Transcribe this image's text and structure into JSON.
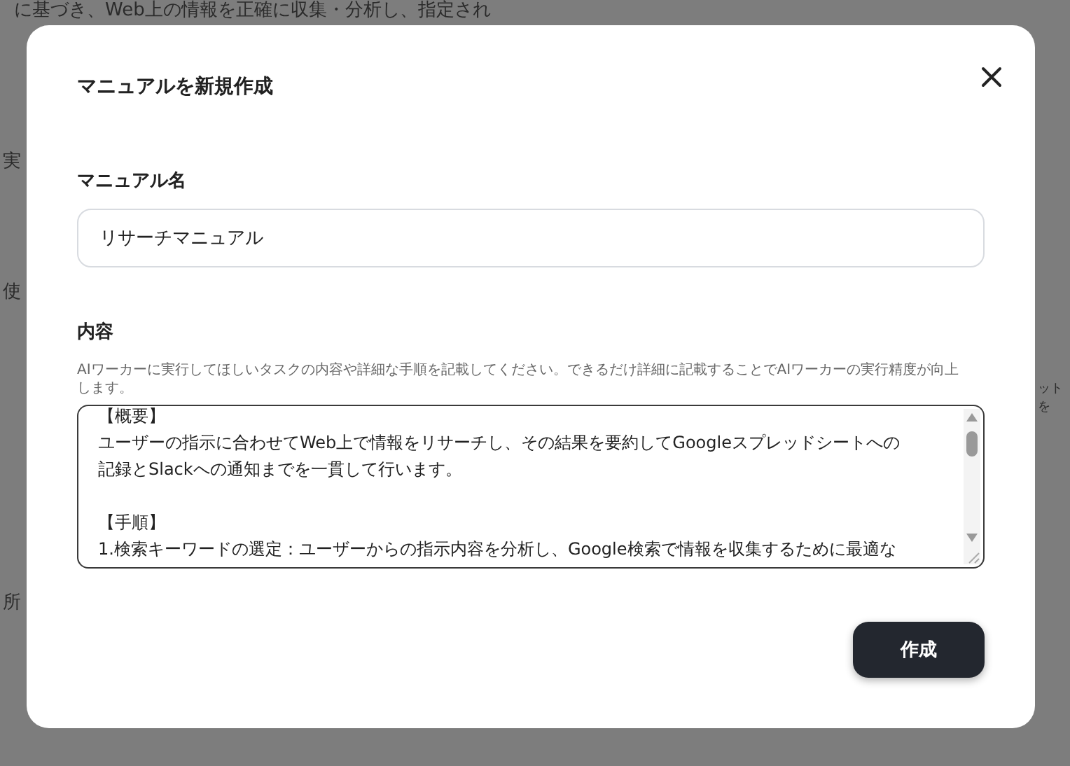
{
  "background": {
    "description_lines": [
      "に基づき、Web上の情報を正確に収集・分析し、指定され"
    ],
    "left_labels": [
      "実",
      "使",
      "所"
    ],
    "right_fragments": [
      "ット",
      "を"
    ]
  },
  "dialog": {
    "title": "マニュアルを新規作成",
    "name_field": {
      "label": "マニュアル名",
      "value": "リサーチマニュアル"
    },
    "content_field": {
      "label": "内容",
      "help": "AIワーカーに実行してほしいタスクの内容や詳細な手順を記載してください。できるだけ詳細に記載することでAIワーカーの実行精度が向上します。",
      "paragraphs": [
        [
          "【概要】",
          "ユーザーの指示に合わせてWeb上で情報をリサーチし、その結果を要約してGoogleスプレッドシートへの",
          "記録とSlackへの通知までを一貫して行います。"
        ],
        [
          "【手順】",
          "1.検索キーワードの選定：ユーザーからの指示内容を分析し、Google検索で情報を収集するために最適な"
        ]
      ]
    },
    "submit_button": "作成"
  }
}
